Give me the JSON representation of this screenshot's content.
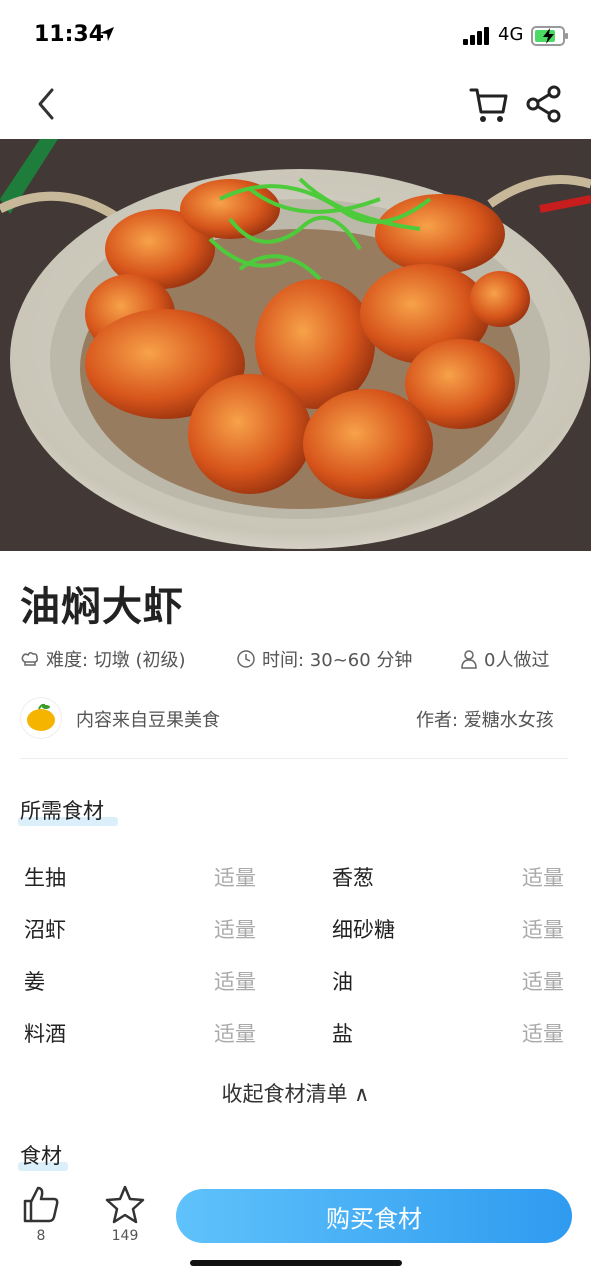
{
  "status_bar": {
    "time": "11:34",
    "network": "4G"
  },
  "nav": {
    "back_icon": "chevron-left-icon",
    "cart_icon": "cart-icon",
    "share_icon": "share-icon"
  },
  "recipe": {
    "title": "油焖大虾",
    "difficulty": "难度: 切墩 (初级)",
    "time": "时间: 30~60 分钟",
    "cooked_count": "0人做过",
    "source": "内容来自豆果美食",
    "author": "作者:  爱糖水女孩"
  },
  "ingredients_section": {
    "title": "所需食材",
    "items": [
      {
        "name": "生抽",
        "qty": "适量"
      },
      {
        "name": "香葱",
        "qty": "适量"
      },
      {
        "name": "沼虾",
        "qty": "适量"
      },
      {
        "name": "细砂糖",
        "qty": "适量"
      },
      {
        "name": "姜",
        "qty": "适量"
      },
      {
        "name": "油",
        "qty": "适量"
      },
      {
        "name": "料酒",
        "qty": "适量"
      },
      {
        "name": "盐",
        "qty": "适量"
      }
    ],
    "collapse_label": "收起食材清单 ∧"
  },
  "food_section": {
    "title": "食材"
  },
  "bottom_bar": {
    "like_count": "8",
    "favorite_count": "149",
    "buy_label": "购买食材"
  },
  "colors": {
    "accent_start": "#5fc2fb",
    "accent_end": "#2f9bf0",
    "highlight": "#dbeffb"
  }
}
